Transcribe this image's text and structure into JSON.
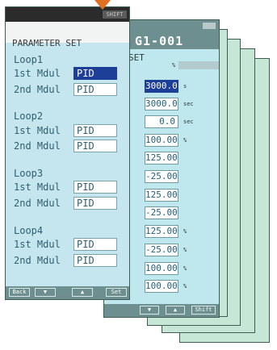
{
  "colors": {
    "card_fill": "#c6e6d6",
    "screen_bg": "#c5e6ee",
    "selected_field": "#1e3f97",
    "function_bar": "#6d8f90",
    "arrow": "#e07020"
  },
  "front_screen": {
    "status_badge": "SHIFT",
    "title": "PARAMETER SET",
    "loops": [
      {
        "label": "Loop1",
        "rows": [
          {
            "label": "1st Mdul",
            "value": "PID"
          },
          {
            "label": "2nd Mdul",
            "value": "PID"
          }
        ]
      },
      {
        "label": "Loop2",
        "rows": [
          {
            "label": "1st Mdul",
            "value": "PID"
          },
          {
            "label": "2nd Mdul",
            "value": "PID"
          }
        ]
      },
      {
        "label": "Loop3",
        "rows": [
          {
            "label": "1st Mdul",
            "value": "PID"
          },
          {
            "label": "2nd Mdul",
            "value": "PID"
          }
        ]
      },
      {
        "label": "Loop4",
        "rows": [
          {
            "label": "1st Mdul",
            "value": "PID"
          },
          {
            "label": "2nd Mdul",
            "value": "PID"
          }
        ]
      }
    ],
    "function_keys": [
      "Back",
      "▼",
      "▲",
      "Set"
    ]
  },
  "back_screen": {
    "title": "G1-001",
    "subtitle": "SET",
    "header_unit": "%",
    "values": [
      {
        "value": "3000.0",
        "unit": "s"
      },
      {
        "value": "3000.0",
        "unit": "sec"
      },
      {
        "value": "0.0",
        "unit": "sec"
      },
      {
        "value": "100.00",
        "unit": "%"
      },
      {
        "value": "125.00",
        "unit": ""
      },
      {
        "value": "-25.00",
        "unit": ""
      },
      {
        "value": "125.00",
        "unit": ""
      },
      {
        "value": "-25.00",
        "unit": ""
      },
      {
        "value": "125.00",
        "unit": "%"
      },
      {
        "value": "-25.00",
        "unit": "%"
      },
      {
        "value": "100.00",
        "unit": "%"
      },
      {
        "value": "100.00",
        "unit": "%"
      }
    ],
    "function_keys": [
      "▼",
      "▲",
      "Shift"
    ]
  }
}
